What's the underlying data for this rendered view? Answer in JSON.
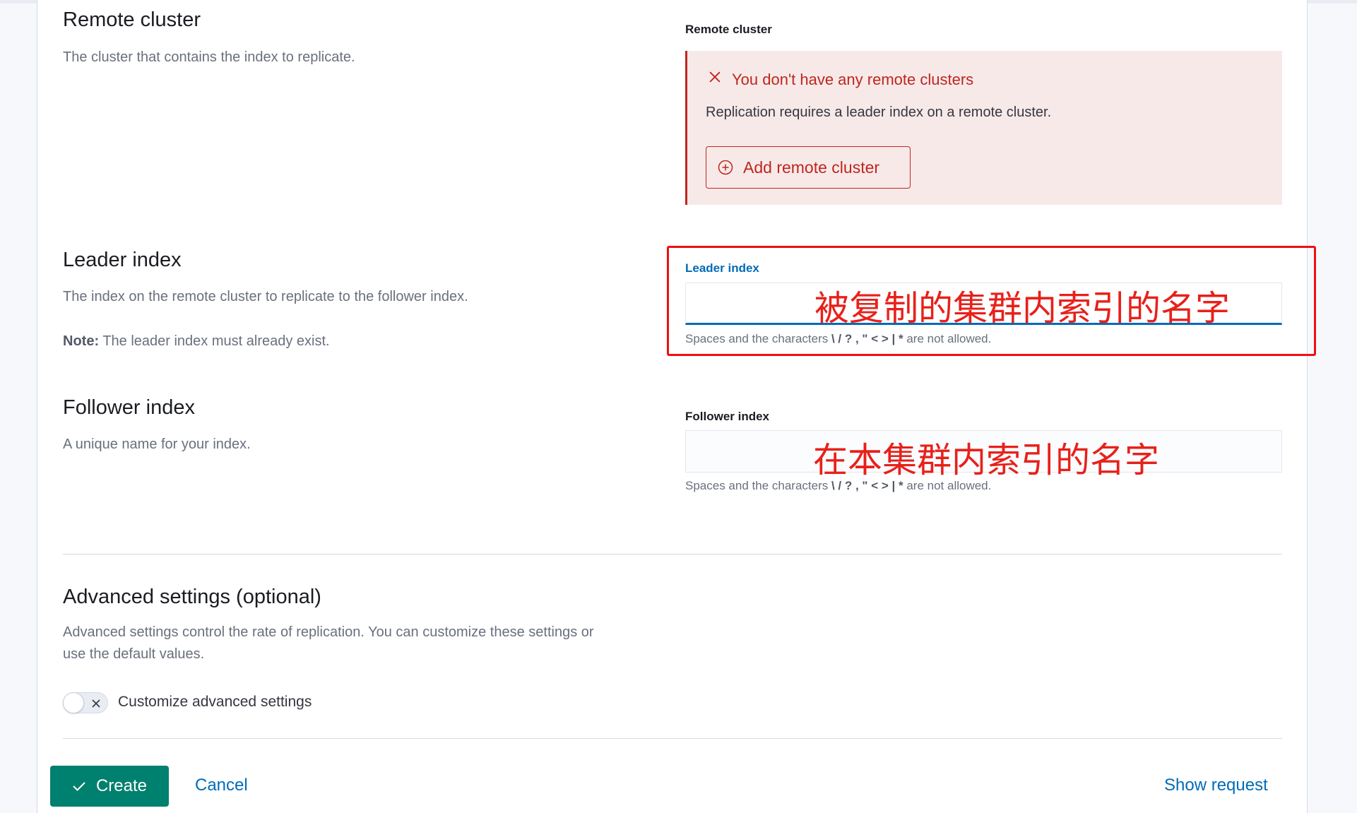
{
  "remote_cluster": {
    "title": "Remote cluster",
    "description": "The cluster that contains the index to replicate.",
    "field_label": "Remote cluster",
    "callout": {
      "title": "You don't have any remote clusters",
      "body": "Replication requires a leader index on a remote cluster.",
      "button_label": "Add remote cluster",
      "icon": "close-icon",
      "button_icon": "plus-in-circle-icon",
      "color": "#bd271e"
    }
  },
  "leader_index": {
    "title": "Leader index",
    "description": "The index on the remote cluster to replicate to the follower index.",
    "note_label": "Note:",
    "note_text": "The leader index must already exist.",
    "field_label": "Leader index",
    "value": "",
    "help_prefix": "Spaces and the characters",
    "help_chars": "\\ / ? , \" < > | *",
    "help_suffix": "are not allowed.",
    "annotation": "被复制的集群内索引的名字"
  },
  "follower_index": {
    "title": "Follower index",
    "description": "A unique name for your index.",
    "field_label": "Follower index",
    "value": "",
    "help_prefix": "Spaces and the characters",
    "help_chars": "\\ / ? , \" < > | *",
    "help_suffix": "are not allowed.",
    "annotation": "在本集群内索引的名字"
  },
  "advanced": {
    "title": "Advanced settings (optional)",
    "description_line1": "Advanced settings control the rate of replication. You can customize these settings or",
    "description_line2": "use the default values.",
    "toggle_label": "Customize advanced settings",
    "toggle_on": false
  },
  "footer": {
    "create_label": "Create",
    "cancel_label": "Cancel",
    "show_request_label": "Show request",
    "primary_color": "#00806e",
    "link_color": "#006bb8"
  },
  "annotation_color": "#e8201a"
}
